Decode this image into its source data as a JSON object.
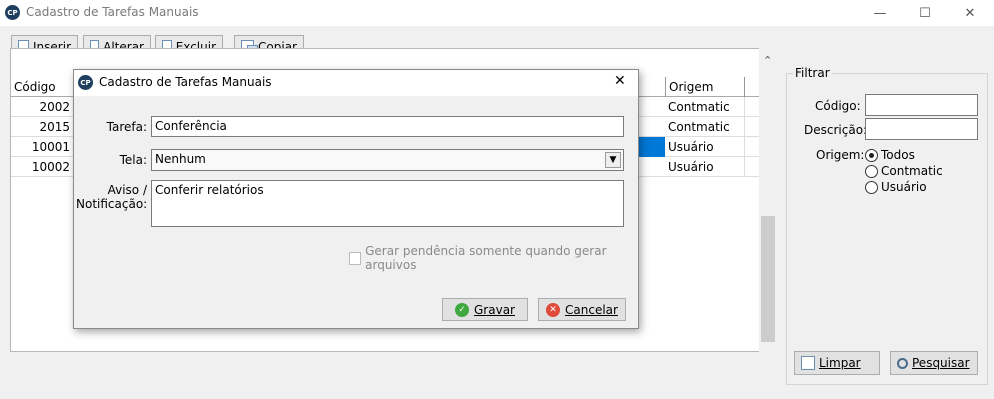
{
  "window": {
    "title": "Cadastro de Tarefas Manuais",
    "logo_text": "CP",
    "minimize_glyph": "—",
    "maximize_glyph": "☐",
    "close_glyph": "✕"
  },
  "toolbar": {
    "insert_label": "Inserir",
    "edit_label": "Alterar",
    "delete_label": "Excluir",
    "copy_label": "Copiar"
  },
  "grid": {
    "columns": [
      "Código",
      "Origem"
    ],
    "rows": [
      {
        "code": "2002",
        "origin": "Contmatic"
      },
      {
        "code": "2015",
        "origin": "Contmatic"
      },
      {
        "code": "10001",
        "origin": "Usuário"
      },
      {
        "code": "10002",
        "origin": "Usuário"
      }
    ],
    "scroll_up": "⌃",
    "scroll_down": "⌄"
  },
  "filter": {
    "title": "Filtrar",
    "code_label": "Código:",
    "code_value": "",
    "description_label": "Descrição:",
    "description_value": "",
    "origin_label": "Origem:",
    "options": [
      "Todos",
      "Contmatic",
      "Usuário"
    ],
    "selected": "Todos",
    "clear_label": "Limpar",
    "search_label": "Pesquisar"
  },
  "dialog": {
    "title": "Cadastro de Tarefas Manuais",
    "close_glyph": "✕",
    "task_label": "Tarefa:",
    "task_value": "Conferência",
    "screen_label": "Tela:",
    "screen_value": "Nenhum",
    "notice_label_line1": "Aviso /",
    "notice_label_line2": "Notificação:",
    "notice_value": "Conferir relatórios",
    "pending_checkbox_label": "Gerar pendência somente quando gerar arquivos",
    "pending_checked": false,
    "save_label": "Gravar",
    "cancel_label": "Cancelar"
  },
  "colors": {
    "selection": "#0078d7",
    "accent_dark": "#1f3f5f"
  }
}
